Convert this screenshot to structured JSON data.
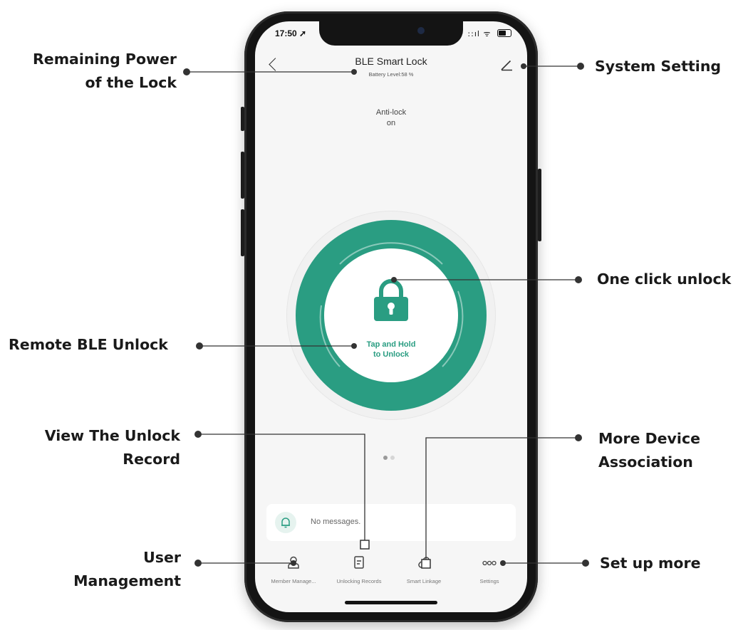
{
  "status_bar": {
    "time": "17:50",
    "icons": "::ıl ᯤ"
  },
  "app": {
    "title": "BLE Smart Lock",
    "battery_text": "Battery Level:58 %",
    "anti_lock_label": "Anti-lock",
    "anti_lock_state": "on",
    "unlock_button": {
      "line1": "Tap and Hold",
      "line2": "to Unlock"
    },
    "page_indicator": {
      "count": 2,
      "active": 0
    },
    "messages": "No messages.",
    "nav": [
      {
        "label": "Member Manage...",
        "icon": "user-icon"
      },
      {
        "label": "Unlocking Records",
        "icon": "record-icon"
      },
      {
        "label": "Smart Linkage",
        "icon": "link-icon"
      },
      {
        "label": "Settings",
        "icon": "more-icon"
      }
    ]
  },
  "callouts": {
    "remaining_power": [
      "Remaining Power",
      "of the Lock"
    ],
    "system_setting": "System Setting",
    "one_click_unlock": "One click unlock",
    "remote_ble_unlock": "Remote BLE Unlock",
    "view_unlock_record": [
      "View The Unlock",
      "Record"
    ],
    "more_device_association": [
      "More Device",
      "Association"
    ],
    "user_management": [
      "User",
      "Management"
    ],
    "set_up_more": "Set up more"
  },
  "colors": {
    "accent": "#2a9d82",
    "accent_light": "#e6f3ef",
    "phone_frame": "#141414"
  }
}
